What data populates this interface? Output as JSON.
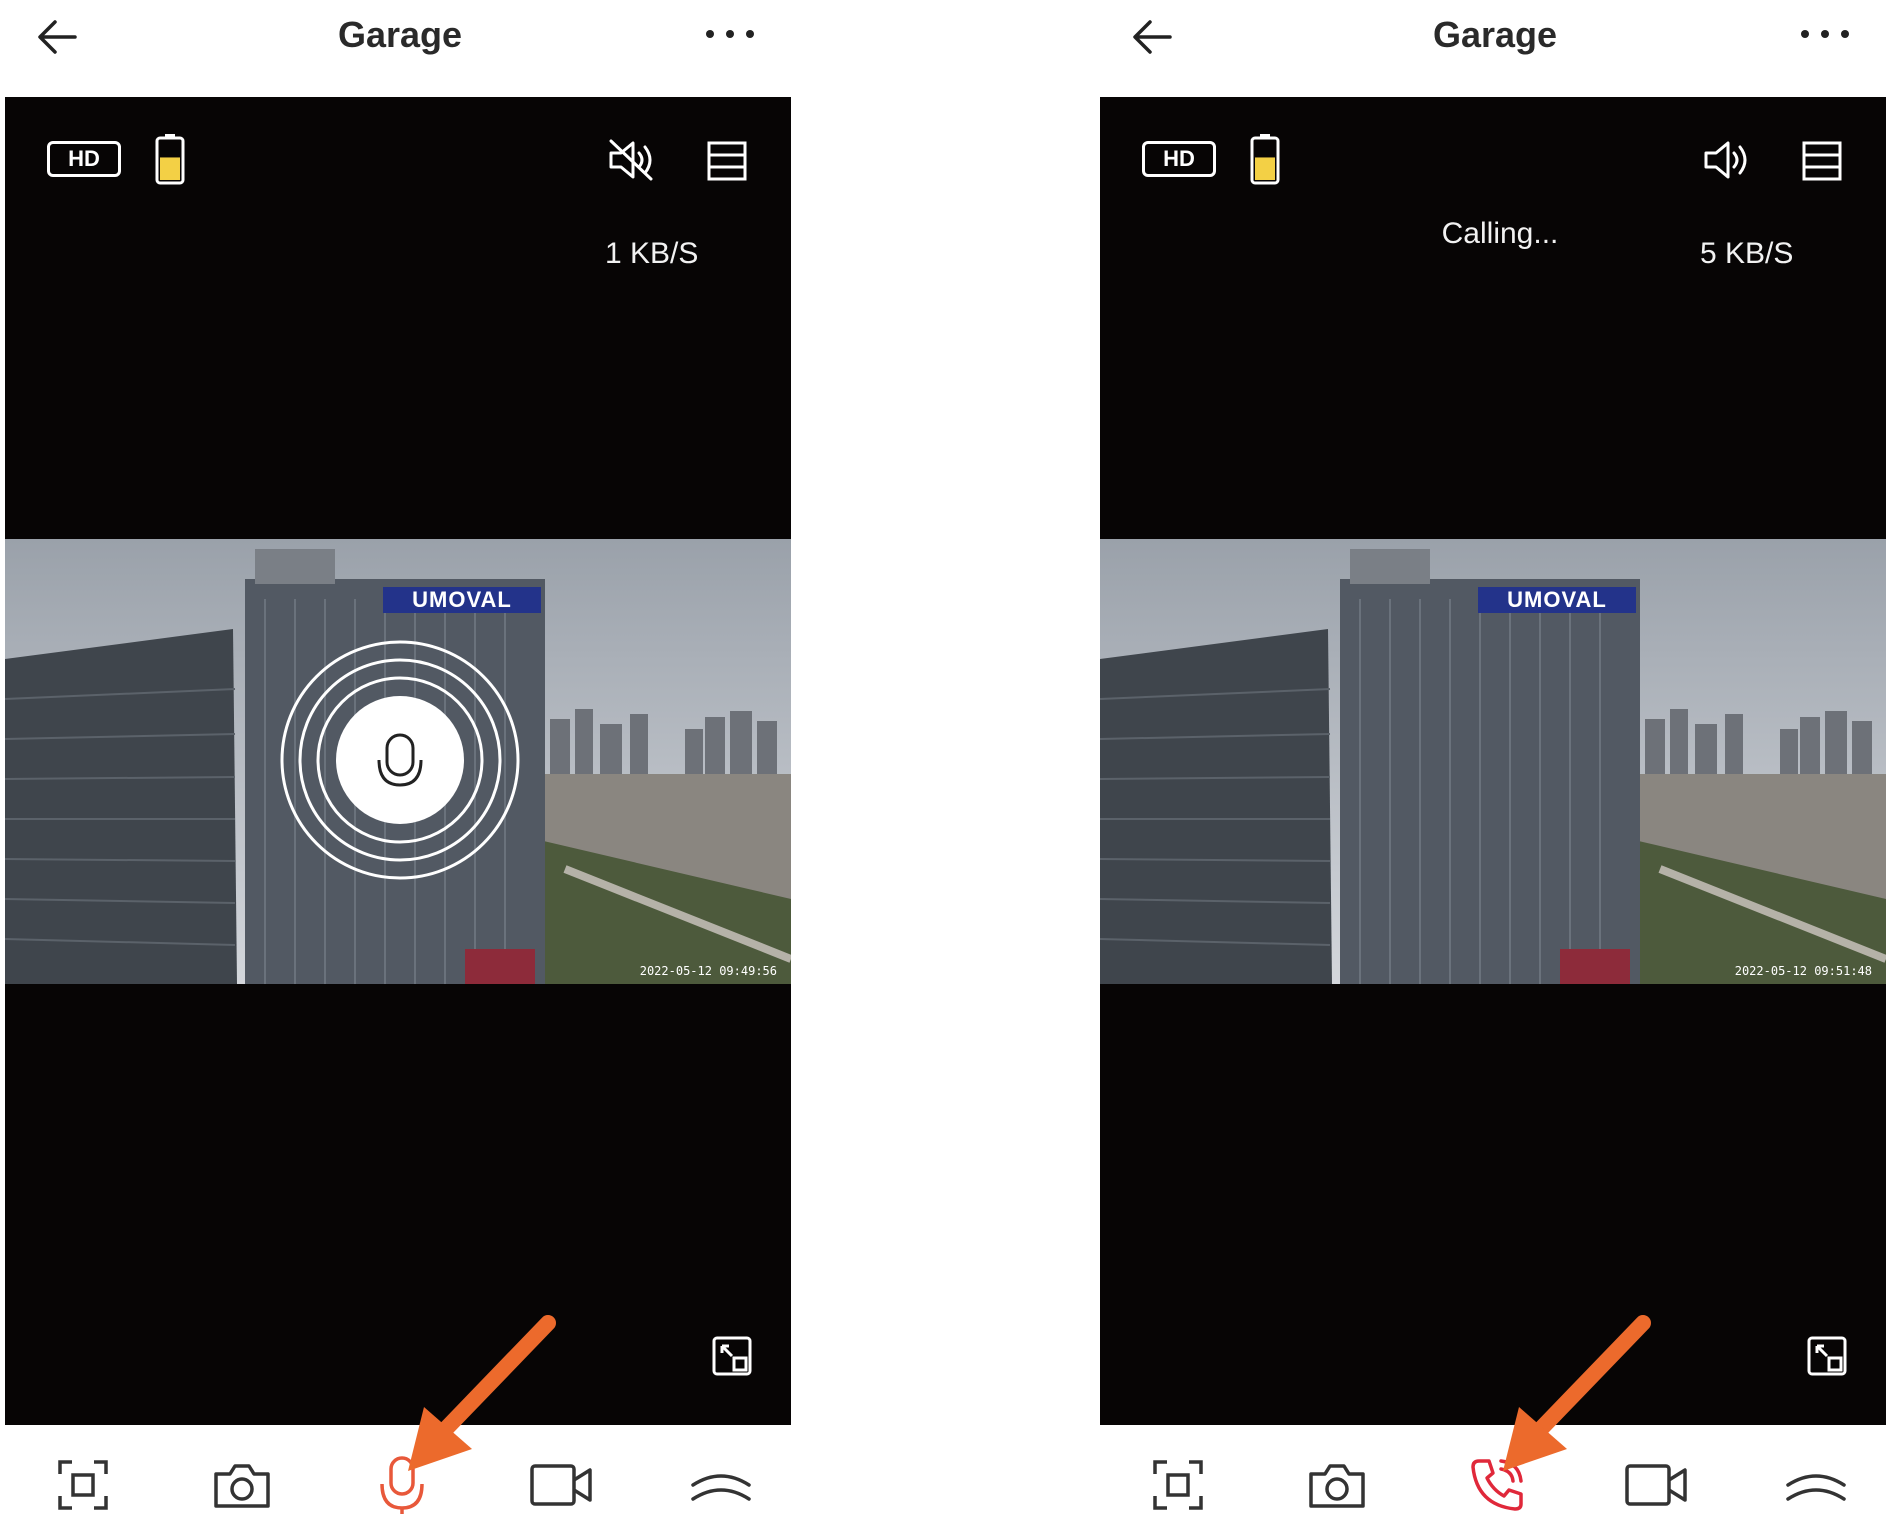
{
  "colors": {
    "accent": "#e8583a",
    "arrow": "#ec6a2c",
    "viewport_bg": "#070505",
    "battery_fill": "#f3d045"
  },
  "screens": [
    {
      "header": {
        "title": "Garage",
        "back_icon": "arrow-left-icon",
        "more_icon": "more-dots-icon"
      },
      "overlay": {
        "hd_label": "HD",
        "speed": "1 KB/S",
        "speaker_icon": "speaker-muted-icon",
        "battery_level": 0.55
      },
      "video": {
        "sign": "UMOVAL",
        "timestamp": "2022-05-12 09:49:56"
      },
      "toolbar": [
        "screenshot-icon",
        "camera-icon",
        "microphone-icon",
        "video-record-icon",
        "expand-up-icon"
      ]
    },
    {
      "header": {
        "title": "Garage",
        "back_icon": "arrow-left-icon",
        "more_icon": "more-dots-icon"
      },
      "overlay": {
        "hd_label": "HD",
        "speed": "5 KB/S",
        "status": "Calling...",
        "speaker_icon": "speaker-on-icon",
        "battery_level": 0.55
      },
      "video": {
        "sign": "UMOVAL",
        "timestamp": "2022-05-12 09:51:48"
      },
      "toolbar": [
        "screenshot-icon",
        "camera-icon",
        "phone-call-icon",
        "video-record-icon",
        "expand-up-icon"
      ]
    }
  ]
}
